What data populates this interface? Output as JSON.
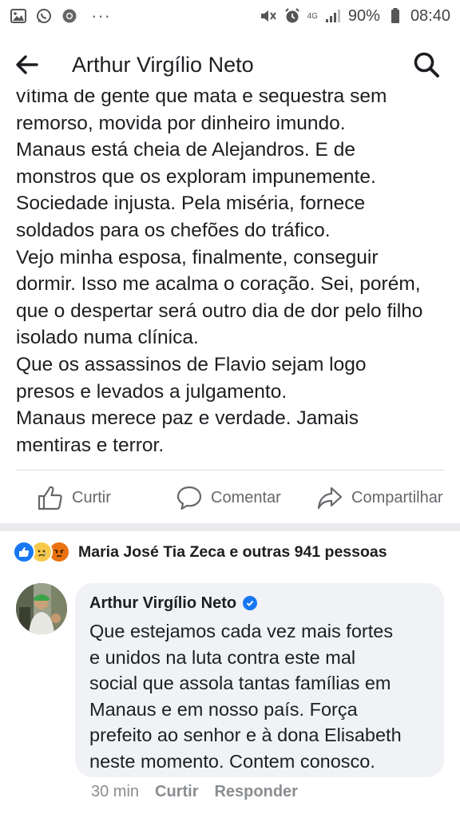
{
  "status_bar": {
    "battery": "90%",
    "time": "08:40",
    "network": "4G",
    "dots": "···",
    "icons": [
      "gallery-icon",
      "whatsapp-icon",
      "chrome-icon",
      "mute-icon",
      "alarm-icon",
      "signal-icon",
      "battery-icon"
    ]
  },
  "header": {
    "title": "Arthur Virgílio Neto",
    "back_icon": "arrow-left-icon",
    "search_icon": "search-icon"
  },
  "post": {
    "lines": [
      "vítima de gente que mata e sequestra sem",
      "remorso, movida por dinheiro imundo.",
      "Manaus está cheia de Alejandros. E de",
      "monstros que os exploram impunemente.",
      "Sociedade injusta. Pela miséria, fornece",
      "soldados para os chefões do tráfico.",
      "Vejo minha esposa, finalmente, conseguir",
      "dormir. Isso me acalma o coração. Sei, porém,",
      "que o despertar será outro dia de dor pelo filho",
      "isolado numa clínica.",
      "Que os assassinos de Flavio sejam logo",
      "presos e levados a julgamento.",
      "Manaus merece paz e verdade. Jamais",
      "mentiras e terror."
    ]
  },
  "actions": {
    "like": "Curtir",
    "comment": "Comentar",
    "share": "Compartilhar"
  },
  "reactions": {
    "text": "Maria José Tia Zeca e outras 941 pessoas",
    "types": [
      "like",
      "sad",
      "angry"
    ]
  },
  "comment": {
    "author": "Arthur Virgílio Neto",
    "verified": true,
    "lines": [
      "Que estejamos cada vez mais fortes",
      "e unidos na luta contra este mal",
      "social que assola tantas famílias em",
      "Manaus e em nosso país.  Força",
      "prefeito ao senhor e à dona Elisabeth",
      "neste momento. Contem conosco."
    ],
    "time": "30 min",
    "like_label": "Curtir",
    "reply_label": "Responder"
  },
  "colors": {
    "accent": "#1877f2",
    "muted": "#65676b",
    "bubble": "#f0f2f5"
  }
}
